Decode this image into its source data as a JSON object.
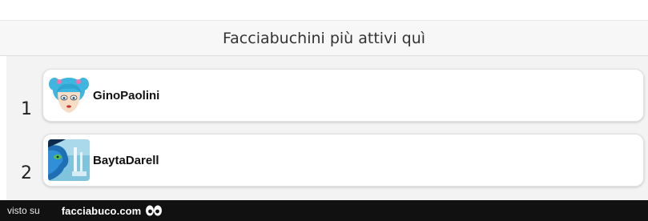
{
  "header": {
    "title": "Facciabuchini più attivi quì"
  },
  "ranking": [
    {
      "rank": "1",
      "username": "GinoPaolini",
      "avatar_icon": "cartoon-face-avatar-icon"
    },
    {
      "rank": "2",
      "username": "BaytaDarell",
      "avatar_icon": "blue-face-avatar-icon"
    }
  ],
  "footer": {
    "visto_su": "visto su",
    "brand": "facciabuco.com",
    "logo_icon": "eyes-logo-icon"
  },
  "colors": {
    "header_bg": "#f7f7f7",
    "list_bg": "#f3f3f3",
    "card_bg": "#ffffff",
    "footer_bg": "#111111",
    "avatar_hair": "#3fb6df"
  }
}
